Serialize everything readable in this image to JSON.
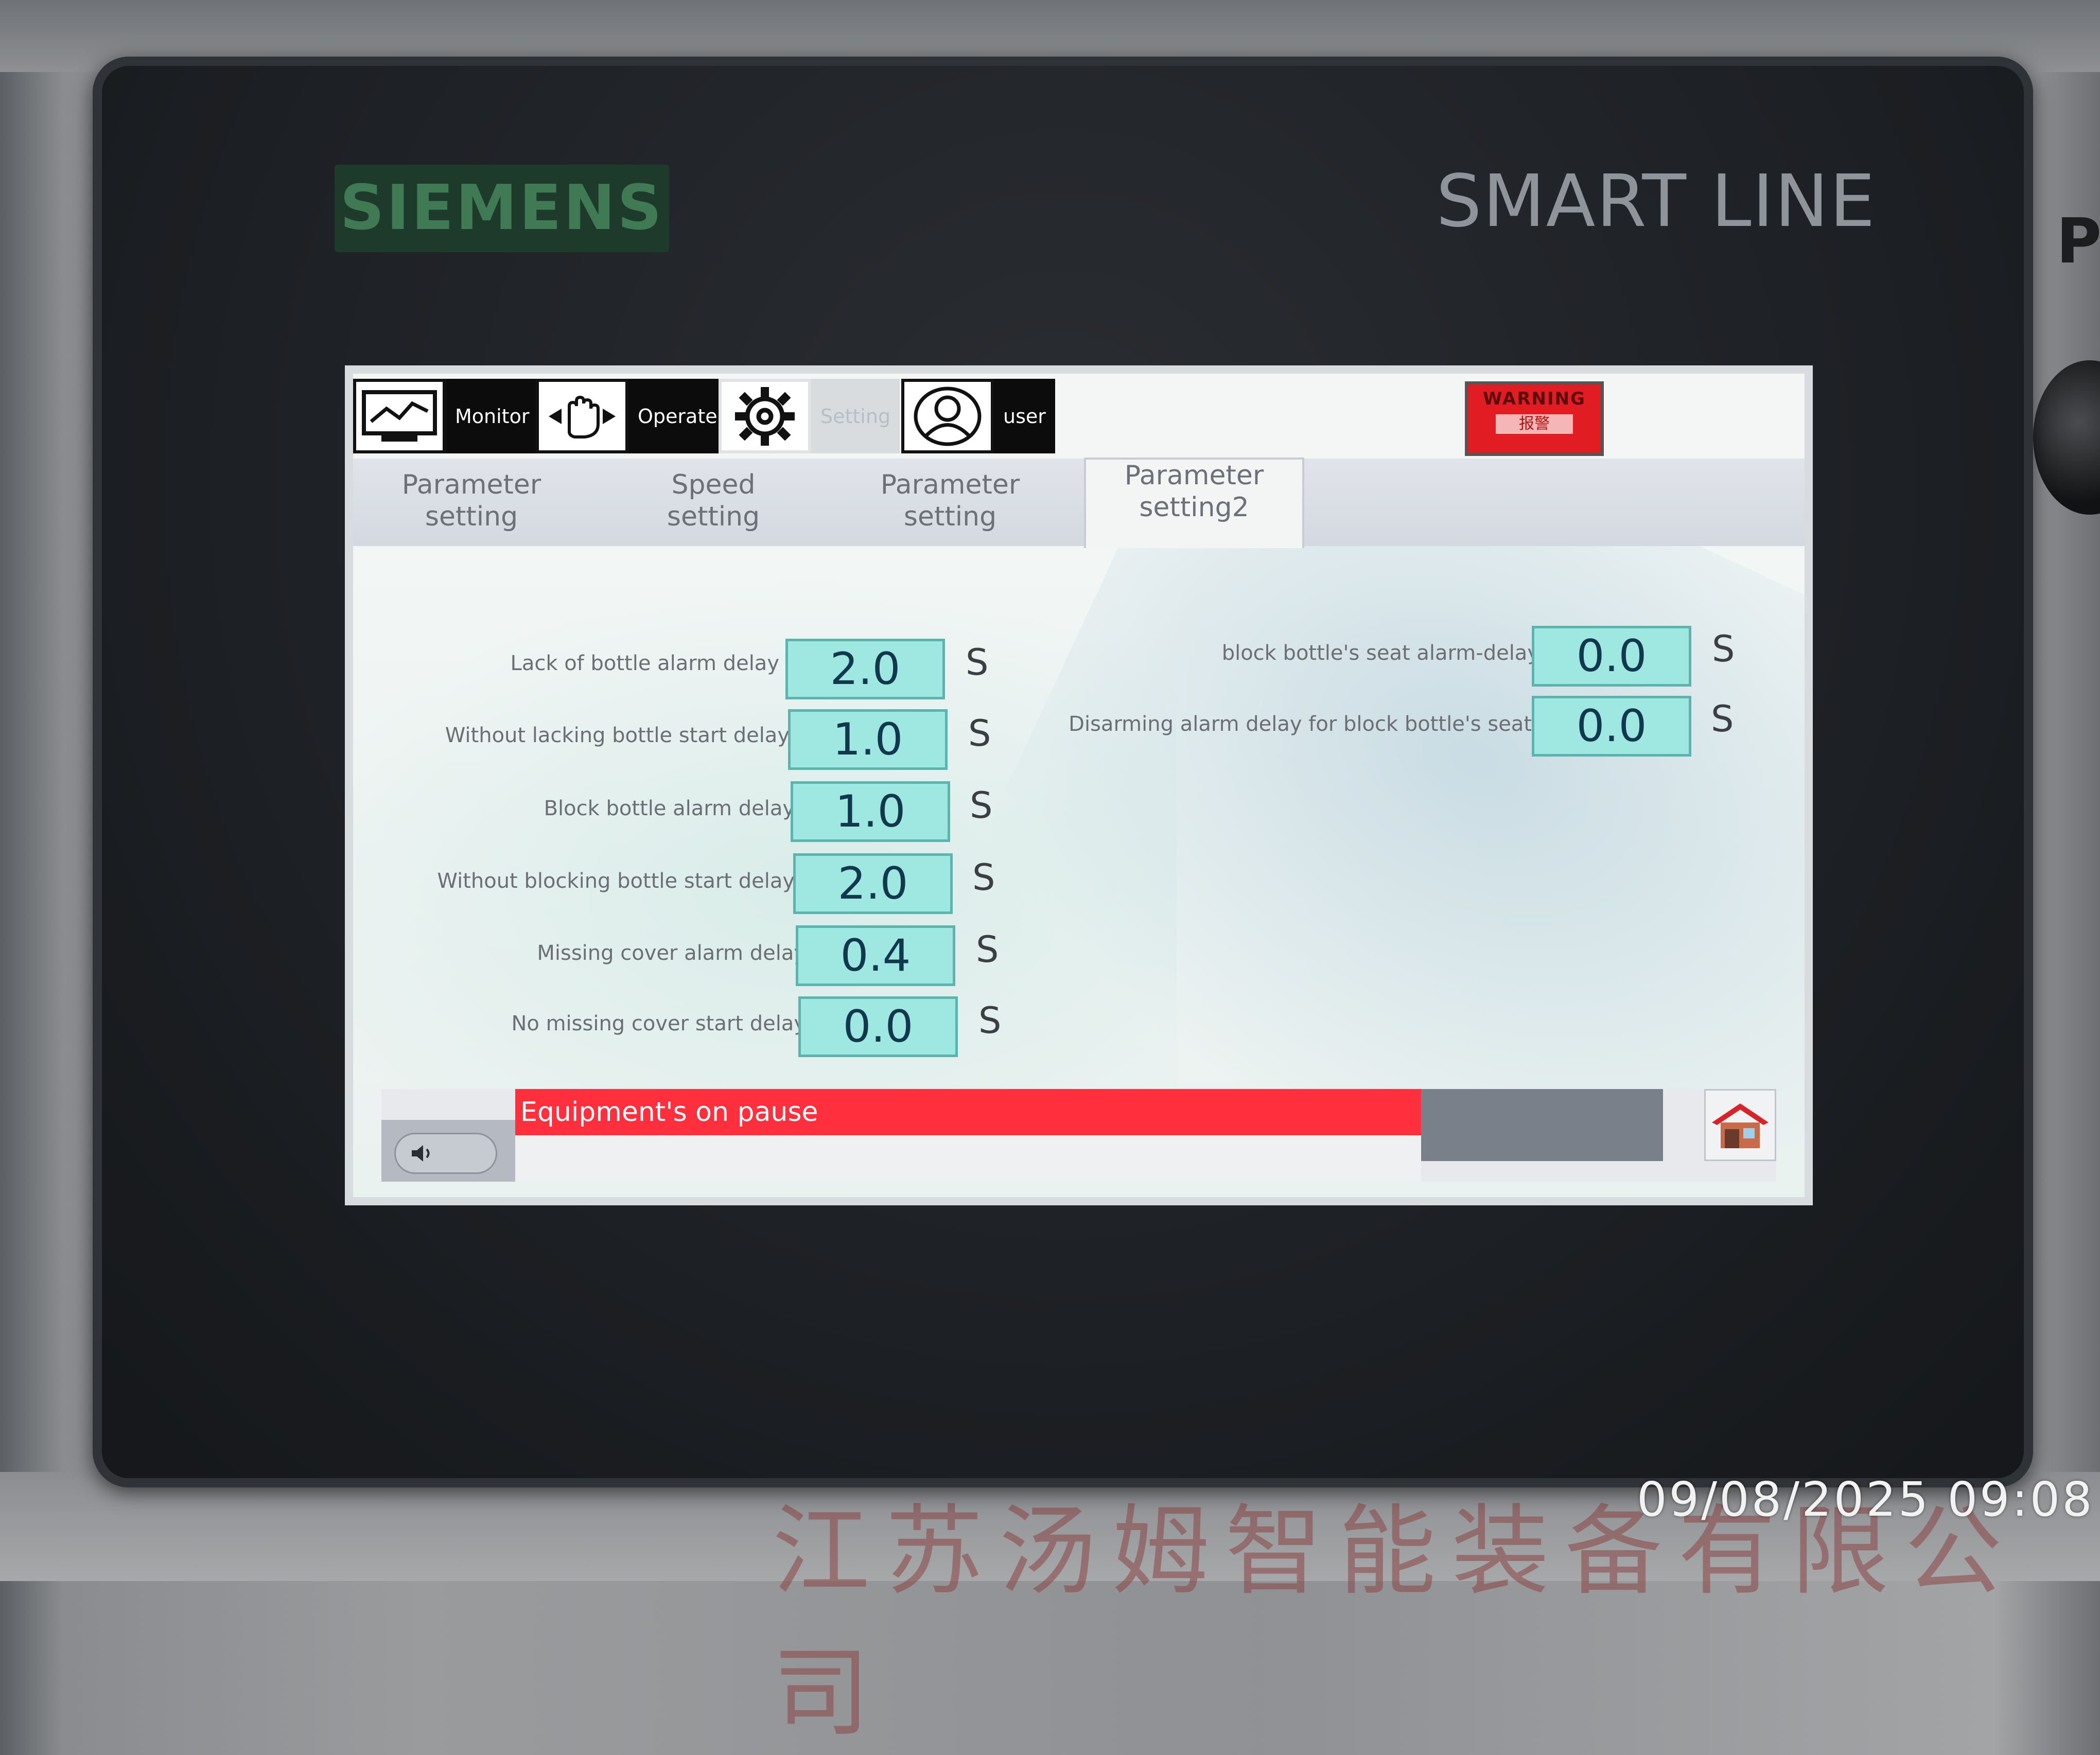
{
  "hardware": {
    "brand": "SIEMENS",
    "series": "SMART LINE",
    "side_label": "PC",
    "panel_text": "江苏汤姆智能装备有限公司"
  },
  "nav": {
    "monitor_label": "Monitor",
    "operate_label": "Operate",
    "setting_label": "Setting",
    "user_label": "user"
  },
  "warning": {
    "title": "WARNING",
    "subtitle": "报警"
  },
  "tabs": [
    {
      "label": "Parameter\nsetting"
    },
    {
      "label": "Speed\nsetting"
    },
    {
      "label": "Parameter\nsetting"
    },
    {
      "label": "Parameter\nsetting2"
    }
  ],
  "left_params": [
    {
      "label": "Lack of bottle alarm delay",
      "value": "2.0",
      "unit": "S"
    },
    {
      "label": "Without lacking bottle start delay",
      "value": "1.0",
      "unit": "S"
    },
    {
      "label": "Block bottle alarm delay",
      "value": "1.0",
      "unit": "S"
    },
    {
      "label": "Without blocking bottle start delay",
      "value": "2.0",
      "unit": "S"
    },
    {
      "label": "Missing cover alarm delay",
      "value": "0.4",
      "unit": "S"
    },
    {
      "label": "No missing cover start delay",
      "value": "0.0",
      "unit": "S"
    }
  ],
  "right_params": [
    {
      "label": "block bottle's seat alarm-delay",
      "value": "0.0",
      "unit": "S"
    },
    {
      "label": "Disarming alarm delay for block bottle's seat",
      "value": "0.0",
      "unit": "S"
    }
  ],
  "status": {
    "message": "Equipment's on pause"
  },
  "timestamp": "09/08/2025 09:08",
  "colors": {
    "value_fill": "#9fe8e1",
    "status_red": "#ff2f3e",
    "warning_red": "#e11c22",
    "brand_green": "#3f7a55"
  }
}
